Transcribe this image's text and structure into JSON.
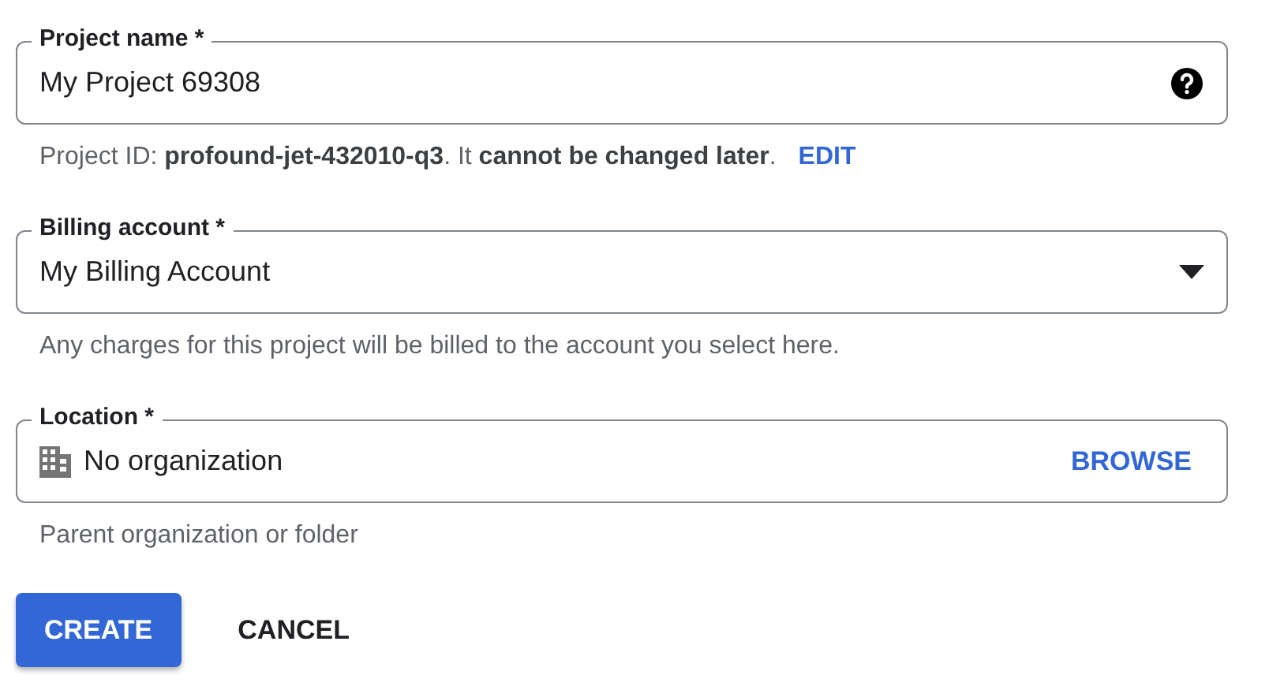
{
  "fields": [
    {
      "kind": "text",
      "label": "Project name *",
      "value": "My Project 69308",
      "helper": "Project ID: **profound-jet-432010-q3**. It **cannot be changed later**.",
      "helper_link": "EDIT"
    },
    {
      "kind": "select",
      "label": "Billing account *",
      "value": "My Billing Account",
      "helper": "Any charges for this project will be billed to the account you select here."
    },
    {
      "kind": "picker",
      "label": "Location *",
      "value": "No organization",
      "action": "BROWSE",
      "helper": "Parent organization or folder"
    }
  ],
  "buttons": [
    {
      "kind": "primary",
      "label": "CREATE"
    },
    {
      "kind": "text",
      "label": "CANCEL"
    }
  ]
}
